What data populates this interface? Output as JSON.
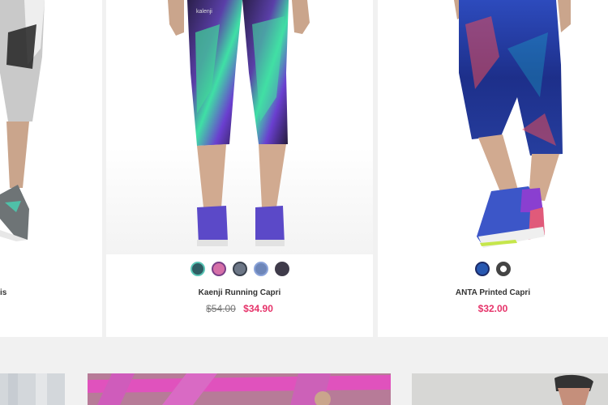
{
  "products": [
    {
      "name_fragment": "is"
    },
    {
      "name": "Kaenji Running Capri",
      "old_price": "$54.00",
      "price": "$34.90",
      "swatch_colors": [
        "#2f5d63",
        "#d56fa8",
        "#6d7787",
        "#6d86b9",
        "#3f3b4a"
      ]
    },
    {
      "name": "ANTA Printed Capri",
      "price": "$32.00",
      "swatch_colors": [
        "#2757b0",
        "#444444"
      ]
    }
  ],
  "colors": {
    "sale": "#e6336a",
    "page_bg": "#f1f1f1",
    "card_bg": "#ffffff"
  }
}
